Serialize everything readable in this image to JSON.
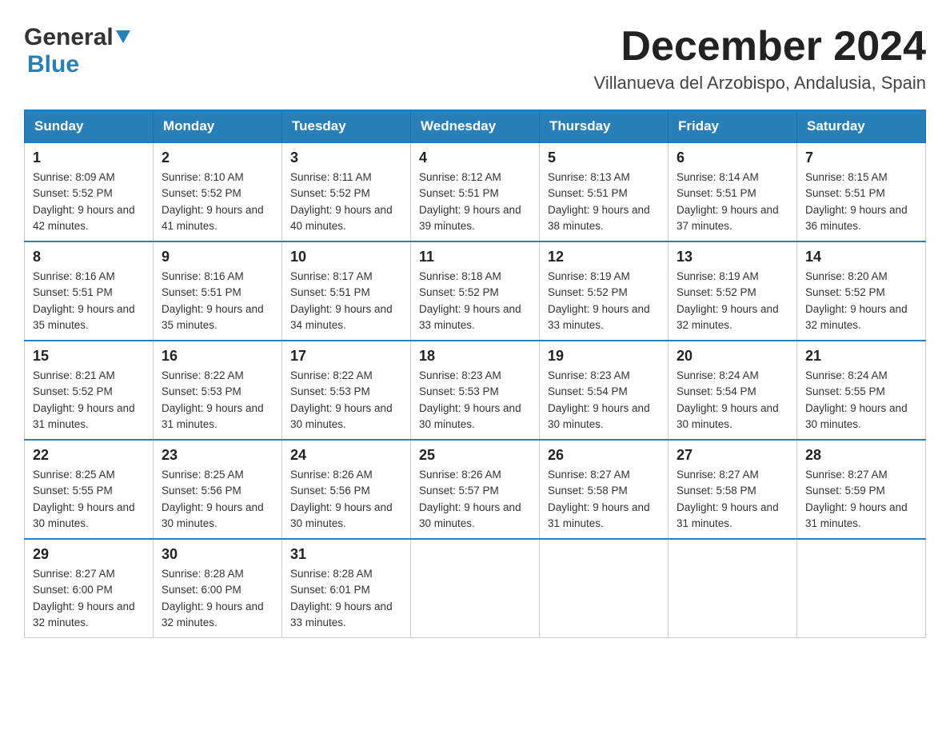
{
  "header": {
    "logo": {
      "general": "General",
      "blue": "Blue"
    },
    "title": "December 2024",
    "location": "Villanueva del Arzobispo, Andalusia, Spain"
  },
  "days_of_week": [
    "Sunday",
    "Monday",
    "Tuesday",
    "Wednesday",
    "Thursday",
    "Friday",
    "Saturday"
  ],
  "weeks": [
    [
      {
        "day": "1",
        "sunrise": "Sunrise: 8:09 AM",
        "sunset": "Sunset: 5:52 PM",
        "daylight": "Daylight: 9 hours and 42 minutes."
      },
      {
        "day": "2",
        "sunrise": "Sunrise: 8:10 AM",
        "sunset": "Sunset: 5:52 PM",
        "daylight": "Daylight: 9 hours and 41 minutes."
      },
      {
        "day": "3",
        "sunrise": "Sunrise: 8:11 AM",
        "sunset": "Sunset: 5:52 PM",
        "daylight": "Daylight: 9 hours and 40 minutes."
      },
      {
        "day": "4",
        "sunrise": "Sunrise: 8:12 AM",
        "sunset": "Sunset: 5:51 PM",
        "daylight": "Daylight: 9 hours and 39 minutes."
      },
      {
        "day": "5",
        "sunrise": "Sunrise: 8:13 AM",
        "sunset": "Sunset: 5:51 PM",
        "daylight": "Daylight: 9 hours and 38 minutes."
      },
      {
        "day": "6",
        "sunrise": "Sunrise: 8:14 AM",
        "sunset": "Sunset: 5:51 PM",
        "daylight": "Daylight: 9 hours and 37 minutes."
      },
      {
        "day": "7",
        "sunrise": "Sunrise: 8:15 AM",
        "sunset": "Sunset: 5:51 PM",
        "daylight": "Daylight: 9 hours and 36 minutes."
      }
    ],
    [
      {
        "day": "8",
        "sunrise": "Sunrise: 8:16 AM",
        "sunset": "Sunset: 5:51 PM",
        "daylight": "Daylight: 9 hours and 35 minutes."
      },
      {
        "day": "9",
        "sunrise": "Sunrise: 8:16 AM",
        "sunset": "Sunset: 5:51 PM",
        "daylight": "Daylight: 9 hours and 35 minutes."
      },
      {
        "day": "10",
        "sunrise": "Sunrise: 8:17 AM",
        "sunset": "Sunset: 5:51 PM",
        "daylight": "Daylight: 9 hours and 34 minutes."
      },
      {
        "day": "11",
        "sunrise": "Sunrise: 8:18 AM",
        "sunset": "Sunset: 5:52 PM",
        "daylight": "Daylight: 9 hours and 33 minutes."
      },
      {
        "day": "12",
        "sunrise": "Sunrise: 8:19 AM",
        "sunset": "Sunset: 5:52 PM",
        "daylight": "Daylight: 9 hours and 33 minutes."
      },
      {
        "day": "13",
        "sunrise": "Sunrise: 8:19 AM",
        "sunset": "Sunset: 5:52 PM",
        "daylight": "Daylight: 9 hours and 32 minutes."
      },
      {
        "day": "14",
        "sunrise": "Sunrise: 8:20 AM",
        "sunset": "Sunset: 5:52 PM",
        "daylight": "Daylight: 9 hours and 32 minutes."
      }
    ],
    [
      {
        "day": "15",
        "sunrise": "Sunrise: 8:21 AM",
        "sunset": "Sunset: 5:52 PM",
        "daylight": "Daylight: 9 hours and 31 minutes."
      },
      {
        "day": "16",
        "sunrise": "Sunrise: 8:22 AM",
        "sunset": "Sunset: 5:53 PM",
        "daylight": "Daylight: 9 hours and 31 minutes."
      },
      {
        "day": "17",
        "sunrise": "Sunrise: 8:22 AM",
        "sunset": "Sunset: 5:53 PM",
        "daylight": "Daylight: 9 hours and 30 minutes."
      },
      {
        "day": "18",
        "sunrise": "Sunrise: 8:23 AM",
        "sunset": "Sunset: 5:53 PM",
        "daylight": "Daylight: 9 hours and 30 minutes."
      },
      {
        "day": "19",
        "sunrise": "Sunrise: 8:23 AM",
        "sunset": "Sunset: 5:54 PM",
        "daylight": "Daylight: 9 hours and 30 minutes."
      },
      {
        "day": "20",
        "sunrise": "Sunrise: 8:24 AM",
        "sunset": "Sunset: 5:54 PM",
        "daylight": "Daylight: 9 hours and 30 minutes."
      },
      {
        "day": "21",
        "sunrise": "Sunrise: 8:24 AM",
        "sunset": "Sunset: 5:55 PM",
        "daylight": "Daylight: 9 hours and 30 minutes."
      }
    ],
    [
      {
        "day": "22",
        "sunrise": "Sunrise: 8:25 AM",
        "sunset": "Sunset: 5:55 PM",
        "daylight": "Daylight: 9 hours and 30 minutes."
      },
      {
        "day": "23",
        "sunrise": "Sunrise: 8:25 AM",
        "sunset": "Sunset: 5:56 PM",
        "daylight": "Daylight: 9 hours and 30 minutes."
      },
      {
        "day": "24",
        "sunrise": "Sunrise: 8:26 AM",
        "sunset": "Sunset: 5:56 PM",
        "daylight": "Daylight: 9 hours and 30 minutes."
      },
      {
        "day": "25",
        "sunrise": "Sunrise: 8:26 AM",
        "sunset": "Sunset: 5:57 PM",
        "daylight": "Daylight: 9 hours and 30 minutes."
      },
      {
        "day": "26",
        "sunrise": "Sunrise: 8:27 AM",
        "sunset": "Sunset: 5:58 PM",
        "daylight": "Daylight: 9 hours and 31 minutes."
      },
      {
        "day": "27",
        "sunrise": "Sunrise: 8:27 AM",
        "sunset": "Sunset: 5:58 PM",
        "daylight": "Daylight: 9 hours and 31 minutes."
      },
      {
        "day": "28",
        "sunrise": "Sunrise: 8:27 AM",
        "sunset": "Sunset: 5:59 PM",
        "daylight": "Daylight: 9 hours and 31 minutes."
      }
    ],
    [
      {
        "day": "29",
        "sunrise": "Sunrise: 8:27 AM",
        "sunset": "Sunset: 6:00 PM",
        "daylight": "Daylight: 9 hours and 32 minutes."
      },
      {
        "day": "30",
        "sunrise": "Sunrise: 8:28 AM",
        "sunset": "Sunset: 6:00 PM",
        "daylight": "Daylight: 9 hours and 32 minutes."
      },
      {
        "day": "31",
        "sunrise": "Sunrise: 8:28 AM",
        "sunset": "Sunset: 6:01 PM",
        "daylight": "Daylight: 9 hours and 33 minutes."
      },
      null,
      null,
      null,
      null
    ]
  ]
}
